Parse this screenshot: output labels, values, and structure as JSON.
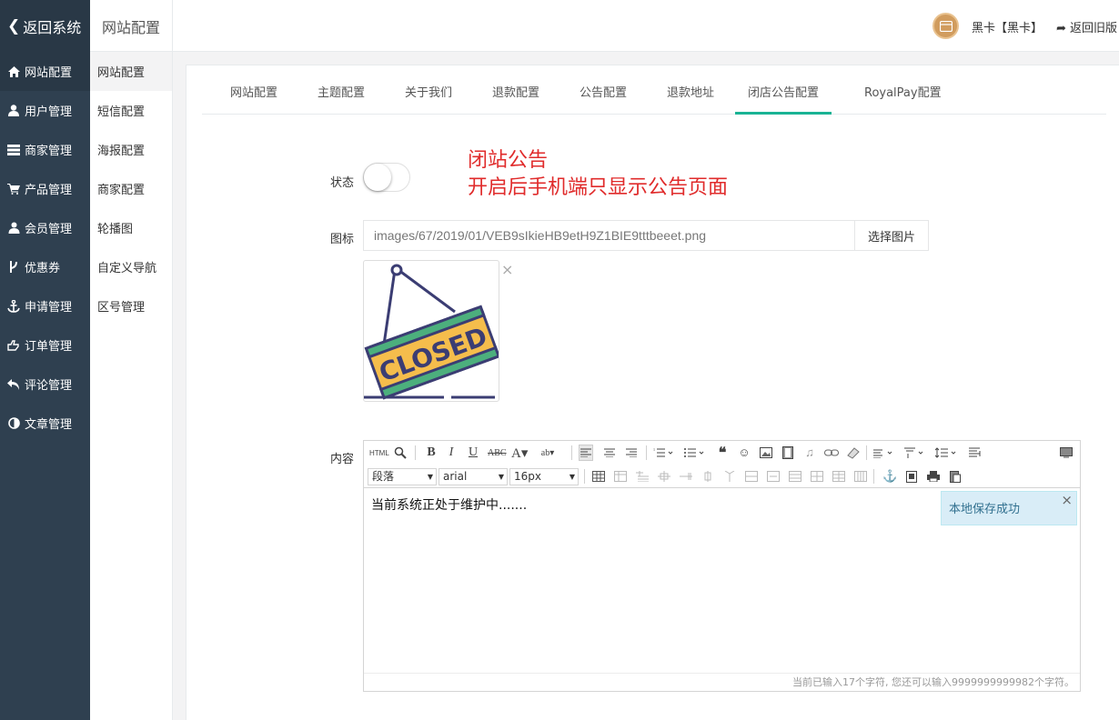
{
  "sidebar": {
    "back_label": "返回系统",
    "items": [
      {
        "label": "网站配置",
        "icon": "home-icon"
      },
      {
        "label": "用户管理",
        "icon": "user-icon"
      },
      {
        "label": "商家管理",
        "icon": "store-icon"
      },
      {
        "label": "产品管理",
        "icon": "cart-icon"
      },
      {
        "label": "会员管理",
        "icon": "members-icon"
      },
      {
        "label": "优惠券",
        "icon": "branch-icon"
      },
      {
        "label": "申请管理",
        "icon": "anchor-icon"
      },
      {
        "label": "订单管理",
        "icon": "hand-icon"
      },
      {
        "label": "评论管理",
        "icon": "reply-icon"
      },
      {
        "label": "文章管理",
        "icon": "half-circle-icon"
      }
    ]
  },
  "subnav": {
    "items": [
      "网站配置",
      "短信配置",
      "海报配置",
      "商家配置",
      "轮播图",
      "自定义导航",
      "区号管理"
    ]
  },
  "header": {
    "title": "网站配置",
    "user": "黑卡【黑卡】",
    "old_version": "返回旧版"
  },
  "tabs": [
    "网站配置",
    "主题配置",
    "关于我们",
    "退款配置",
    "公告配置",
    "退款地址",
    "闭店公告配置",
    "RoyalPay配置"
  ],
  "form": {
    "notice_title": "闭站公告",
    "notice_desc": "开启后手机端只显示公告页面",
    "status_label": "状态",
    "status_on": false,
    "icon_label": "图标",
    "icon_path": "images/67/2019/01/VEB9sIkieHB9etH9Z1BIE9tttbeeet.png",
    "pick_button": "选择图片",
    "remove_symbol": "×",
    "preview_text": "CLOSED",
    "content_label": "内容"
  },
  "editor": {
    "html_label": "HTML",
    "format": "段落",
    "font": "arial",
    "size": "16px",
    "content": "当前系统正处于维护中.......",
    "toast": "本地保存成功",
    "toast_close": "×",
    "counter": "当前已输入17个字符, 您还可以输入9999999999982个字符。"
  },
  "colors": {
    "sidebar_bg": "#2f4050",
    "accent": "#1ab394",
    "notice_red": "#e02b2b"
  }
}
